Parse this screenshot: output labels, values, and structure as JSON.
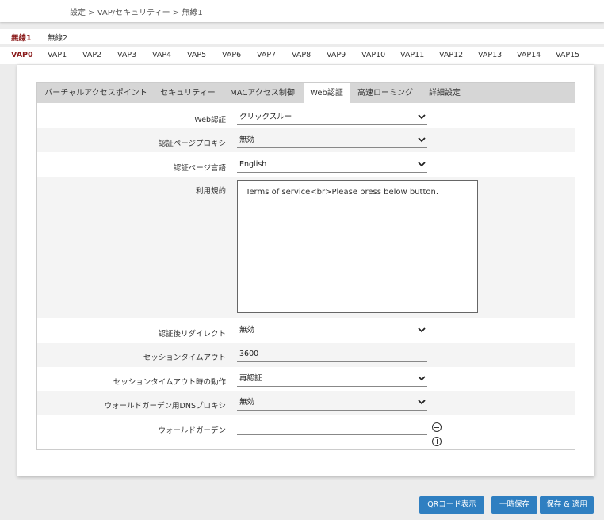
{
  "breadcrumb": "設定 > VAP/セキュリティー > 無線1",
  "radio_tabs": [
    "無線1",
    "無線2"
  ],
  "vap_tabs": [
    "VAP0",
    "VAP1",
    "VAP2",
    "VAP3",
    "VAP4",
    "VAP5",
    "VAP6",
    "VAP7",
    "VAP8",
    "VAP9",
    "VAP10",
    "VAP11",
    "VAP12",
    "VAP13",
    "VAP14",
    "VAP15"
  ],
  "sub_tabs": [
    "バーチャルアクセスポイント",
    "セキュリティー",
    "MACアクセス制御",
    "Web認証",
    "高速ローミング",
    "詳細設定"
  ],
  "active_sub_tab": "Web認証",
  "form": {
    "web_auth": {
      "label": "Web認証",
      "value": "クリックスルー"
    },
    "auth_page_proxy": {
      "label": "認証ページプロキシ",
      "value": "無効"
    },
    "auth_page_lang": {
      "label": "認証ページ言語",
      "value": "English"
    },
    "terms": {
      "label": "利用規約",
      "value": "Terms of service<br>Please press below button."
    },
    "post_auth_redirect": {
      "label": "認証後リダイレクト",
      "value": "無効"
    },
    "session_timeout": {
      "label": "セッションタイムアウト",
      "value": "3600"
    },
    "session_timeout_action": {
      "label": "セッションタイムアウト時の動作",
      "value": "再認証"
    },
    "walled_garden_dns_proxy": {
      "label": "ウォールドガーデン用DNSプロキシ",
      "value": "無効"
    },
    "walled_garden": {
      "label": "ウォールドガーデン",
      "value": ""
    }
  },
  "buttons": {
    "qr": "QRコード表示",
    "temp_save": "一時保存",
    "save_apply": "保存 & 適用"
  },
  "colors": {
    "accent": "#8b1c1c",
    "button": "#2f7fc1"
  }
}
